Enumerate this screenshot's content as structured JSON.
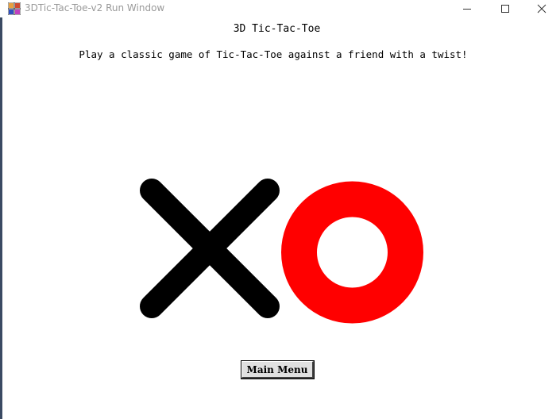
{
  "window": {
    "title": "3DTic-Tac-Toe-v2 Run Window",
    "controls": {
      "minimize_icon": "minimize-icon",
      "maximize_icon": "maximize-icon",
      "close_icon": "close-icon"
    },
    "app_icon": "app-icon"
  },
  "game": {
    "title": "3D Tic-Tac-Toe",
    "subtitle": "Play a classic game of Tic-Tac-Toe against a friend with a twist!"
  },
  "logo": {
    "x_mark_color": "#000000",
    "o_mark_color": "#ff0000"
  },
  "buttons": {
    "main_menu_label": "Main Menu"
  }
}
